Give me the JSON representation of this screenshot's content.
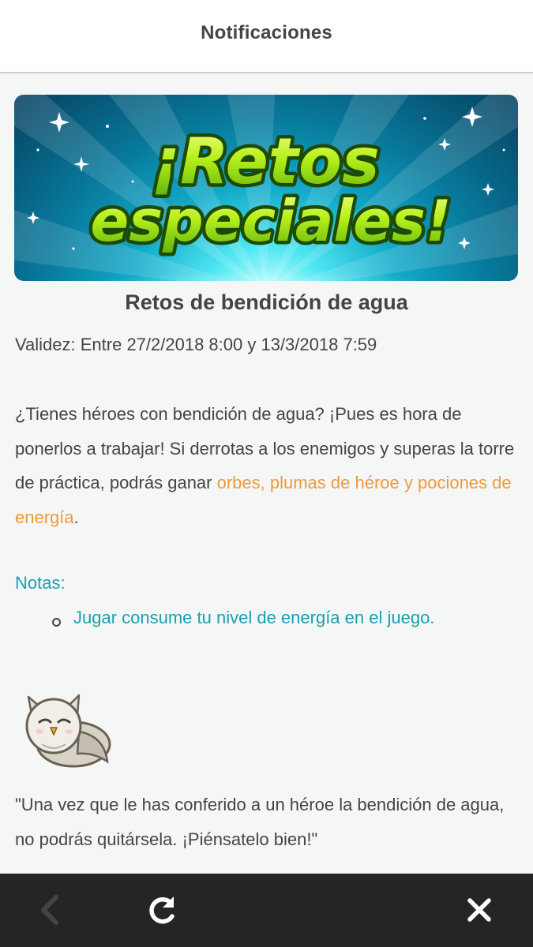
{
  "header": {
    "title": "Notificaciones"
  },
  "banner": {
    "line1": "¡Retos",
    "line2": "especiales!"
  },
  "article": {
    "title": "Retos de bendición de agua",
    "validity": "Validez: Entre 27/2/2018 8:00 y 13/3/2018 7:59",
    "paragraph_text": "¿Tienes héroes con bendición de agua? ¡Pues es hora de ponerlos a trabajar! Si derrotas a los enemigos y superas la torre de práctica, podrás ganar ",
    "paragraph_highlight": "orbes, plumas de héroe y pociones de energía",
    "paragraph_end": ".",
    "notes_label": "Notas:",
    "notes_items": [
      "Jugar consume tu nivel de energía en el juego."
    ],
    "quote": "\"Una vez que le has conferido a un héroe la bendición de agua, no podrás quitársela. ¡Piénsatelo bien!\""
  },
  "bottom_bar": {
    "buttons": [
      {
        "name": "back",
        "icon": "chevron-left-icon"
      },
      {
        "name": "reload",
        "icon": "reload-icon"
      },
      {
        "name": "close",
        "icon": "close-icon"
      }
    ]
  },
  "colors": {
    "highlight": "#ee9a37",
    "notes": "#1a9fb3",
    "bottom_bar": "#252525",
    "text": "#444444"
  }
}
